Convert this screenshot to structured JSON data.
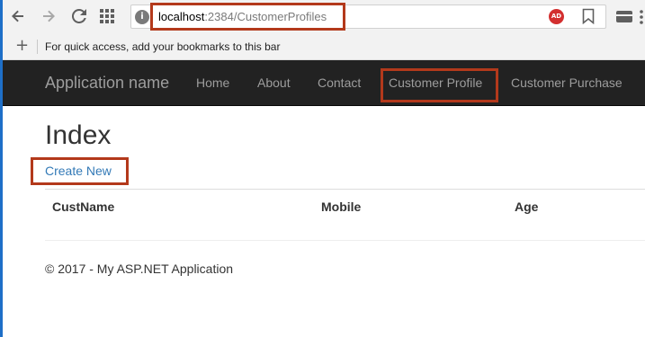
{
  "browser": {
    "url_host": "localhost",
    "url_path": ":2384/CustomerProfiles",
    "info_icon_glyph": "i",
    "adblock_label": "AD",
    "icons": [
      "back-icon",
      "forward-icon",
      "reload-icon",
      "apps-grid-icon",
      "site-info-icon",
      "adblock-icon",
      "bookmark-star-icon",
      "payment-card-icon",
      "menu-icon"
    ]
  },
  "bookmarks_bar": {
    "add_glyph": "+",
    "message": "For quick access, add your bookmarks to this bar"
  },
  "navbar": {
    "brand": "Application name",
    "links": [
      "Home",
      "About",
      "Contact",
      "Customer Profile",
      "Customer Purchase"
    ],
    "highlighted_link": "Customer Profile"
  },
  "main": {
    "title": "Index",
    "create_link": "Create New",
    "table": {
      "headers": [
        "CustName",
        "Mobile",
        "Age"
      ],
      "rows": []
    }
  },
  "footer": {
    "text": "© 2017 - My ASP.NET Application"
  },
  "colors": {
    "highlight_border": "#b3391b",
    "navbar_bg": "#222222",
    "link": "#337ab7"
  }
}
